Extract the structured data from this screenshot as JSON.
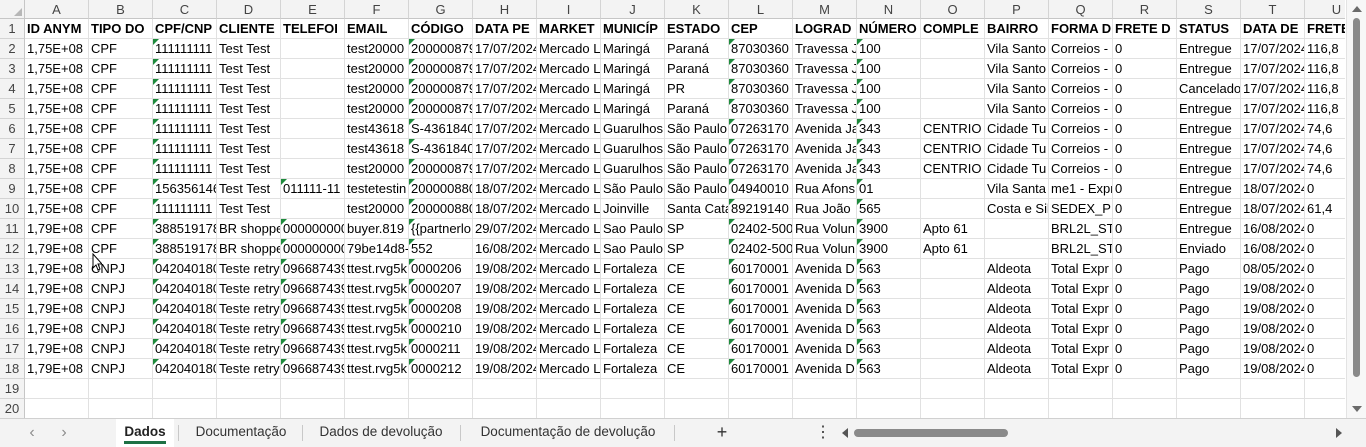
{
  "columns": [
    "A",
    "B",
    "C",
    "D",
    "E",
    "F",
    "G",
    "H",
    "I",
    "J",
    "K",
    "L",
    "M",
    "N",
    "O",
    "P",
    "Q",
    "R",
    "S",
    "T",
    "U"
  ],
  "row_numbers": [
    "1",
    "2",
    "3",
    "4",
    "5",
    "6",
    "7",
    "8",
    "9",
    "10",
    "11",
    "12",
    "13",
    "14",
    "15",
    "16",
    "17",
    "18",
    "19",
    "20"
  ],
  "headers": [
    "ID ANYM",
    "TIPO DO",
    "CPF/CNP",
    "CLIENTE",
    "TELEFOI",
    "EMAIL",
    "CÓDIGO",
    "DATA PE",
    "MARKET",
    "MUNICÍP",
    "ESTADO",
    "CEP",
    "LOGRAD",
    "NÚMERO",
    "COMPLE",
    "BAIRRO",
    "FORMA D",
    "FRETE D",
    "STATUS",
    "DATA DE",
    "FRETE"
  ],
  "rows": [
    [
      "1,75E+08",
      "CPF",
      "111111111",
      "Test Test",
      "",
      "test20000",
      "200000879",
      "17/07/2024",
      "Mercado L",
      "Maringá",
      "Paraná",
      "87030360",
      "Travessa J",
      "100",
      "",
      "Vila Santo",
      "Correios -",
      "0",
      "Entregue",
      "17/07/2024",
      "116,8"
    ],
    [
      "1,75E+08",
      "CPF",
      "111111111",
      "Test Test",
      "",
      "test20000",
      "200000879",
      "17/07/2024",
      "Mercado L",
      "Maringá",
      "Paraná",
      "87030360",
      "Travessa J",
      "100",
      "",
      "Vila Santo",
      "Correios -",
      "0",
      "Entregue",
      "17/07/2024",
      "116,8"
    ],
    [
      "1,75E+08",
      "CPF",
      "111111111",
      "Test Test",
      "",
      "test20000",
      "200000879",
      "17/07/2024",
      "Mercado L",
      "Maringá",
      "PR",
      "87030360",
      "Travessa J",
      "100",
      "",
      "Vila Santo",
      "Correios -",
      "0",
      "Cancelado",
      "17/07/2024",
      "116,8"
    ],
    [
      "1,75E+08",
      "CPF",
      "111111111",
      "Test Test",
      "",
      "test20000",
      "200000879",
      "17/07/2024",
      "Mercado L",
      "Maringá",
      "Paraná",
      "87030360",
      "Travessa J",
      "100",
      "",
      "Vila Santo",
      "Correios -",
      "0",
      "Entregue",
      "17/07/2024",
      "116,8"
    ],
    [
      "1,75E+08",
      "CPF",
      "111111111",
      "Test Test",
      "",
      "test43618",
      "S-4361840",
      "17/07/2024",
      "Mercado L",
      "Guarulhos",
      "São Paulo",
      "07263170",
      "Avenida Ja",
      "343",
      "CENTRIO",
      "Cidade Tu",
      "Correios -",
      "0",
      "Entregue",
      "17/07/2024",
      "74,6"
    ],
    [
      "1,75E+08",
      "CPF",
      "111111111",
      "Test Test",
      "",
      "test43618",
      "S-4361840",
      "17/07/2024",
      "Mercado L",
      "Guarulhos",
      "São Paulo",
      "07263170",
      "Avenida Ja",
      "343",
      "CENTRIO",
      "Cidade Tu",
      "Correios -",
      "0",
      "Entregue",
      "17/07/2024",
      "74,6"
    ],
    [
      "1,75E+08",
      "CPF",
      "111111111",
      "Test Test",
      "",
      "test20000",
      "200000879",
      "17/07/2024",
      "Mercado L",
      "Guarulhos",
      "São Paulo",
      "07263170",
      "Avenida Ja",
      "343",
      "CENTRIO",
      "Cidade Tu",
      "Correios -",
      "0",
      "Entregue",
      "17/07/2024",
      "74,6"
    ],
    [
      "1,75E+08",
      "CPF",
      "156356146",
      "Test Test",
      "011111-11",
      "testetestin",
      "200000880",
      "18/07/2024",
      "Mercado L",
      "São Paulo",
      "São Paulo",
      "04940010",
      "Rua Afons",
      "01",
      "",
      "Vila Santa",
      "me1 - Expr",
      "0",
      "Entregue",
      "18/07/2024",
      "0"
    ],
    [
      "1,75E+08",
      "CPF",
      "111111111",
      "Test Test",
      "",
      "test20000",
      "200000880",
      "18/07/2024",
      "Mercado L",
      "Joinville",
      "Santa Cata",
      "89219140",
      "Rua João",
      "565",
      "",
      "Costa e Sil",
      "SEDEX_PL/",
      "0",
      "Entregue",
      "18/07/2024",
      "61,4"
    ],
    [
      "1,79E+08",
      "CPF",
      "388519178",
      "BR shoppe",
      "000000000",
      "buyer.819",
      "{{partnerlo",
      "29/07/2024",
      "Mercado L",
      "Sao Paulo",
      "SP",
      "02402-500",
      "Rua Volun",
      "3900",
      "Apto 61",
      "",
      "BRL2L_STA",
      "0",
      "Entregue",
      "16/08/2024",
      "0"
    ],
    [
      "1,79E+08",
      "CPF",
      "388519178",
      "BR shoppe",
      "000000000",
      "79be14d8-",
      "552",
      "16/08/2024",
      "Mercado L",
      "Sao Paulo",
      "SP",
      "02402-500",
      "Rua Volun",
      "3900",
      "Apto 61",
      "",
      "BRL2L_STA",
      "0",
      "Enviado",
      "16/08/2024",
      "0"
    ],
    [
      "1,79E+08",
      "CNPJ",
      "042040180",
      "Teste retry",
      "096687439",
      "ttest.rvg5k",
      "0000206",
      "19/08/2024",
      "Mercado L",
      "Fortaleza",
      "CE",
      "60170001",
      "Avenida D",
      "563",
      "",
      "Aldeota",
      "Total Expr",
      "0",
      "Pago",
      "08/05/2024",
      "0"
    ],
    [
      "1,79E+08",
      "CNPJ",
      "042040180",
      "Teste retry",
      "096687439",
      "ttest.rvg5k",
      "0000207",
      "19/08/2024",
      "Mercado L",
      "Fortaleza",
      "CE",
      "60170001",
      "Avenida D",
      "563",
      "",
      "Aldeota",
      "Total Expr",
      "0",
      "Pago",
      "19/08/2024",
      "0"
    ],
    [
      "1,79E+08",
      "CNPJ",
      "042040180",
      "Teste retry",
      "096687439",
      "ttest.rvg5k",
      "0000208",
      "19/08/2024",
      "Mercado L",
      "Fortaleza",
      "CE",
      "60170001",
      "Avenida D",
      "563",
      "",
      "Aldeota",
      "Total Expr",
      "0",
      "Pago",
      "19/08/2024",
      "0"
    ],
    [
      "1,79E+08",
      "CNPJ",
      "042040180",
      "Teste retry",
      "096687439",
      "ttest.rvg5k",
      "0000210",
      "19/08/2024",
      "Mercado L",
      "Fortaleza",
      "CE",
      "60170001",
      "Avenida D",
      "563",
      "",
      "Aldeota",
      "Total Expr",
      "0",
      "Pago",
      "19/08/2024",
      "0"
    ],
    [
      "1,79E+08",
      "CNPJ",
      "042040180",
      "Teste retry",
      "096687439",
      "ttest.rvg5k",
      "0000211",
      "19/08/2024",
      "Mercado L",
      "Fortaleza",
      "CE",
      "60170001",
      "Avenida D",
      "563",
      "",
      "Aldeota",
      "Total Expr",
      "0",
      "Pago",
      "19/08/2024",
      "0"
    ],
    [
      "1,79E+08",
      "CNPJ",
      "042040180",
      "Teste retry",
      "096687439",
      "ttest.rvg5k",
      "0000212",
      "19/08/2024",
      "Mercado L",
      "Fortaleza",
      "CE",
      "60170001",
      "Avenida D",
      "563",
      "",
      "Aldeota",
      "Total Expr",
      "0",
      "Pago",
      "19/08/2024",
      "0"
    ]
  ],
  "number_columns": [
    0,
    17,
    20
  ],
  "text_as_number_columns": [
    2,
    4,
    6,
    11,
    13
  ],
  "sheet_tabs": [
    "Dados",
    "Documentação",
    "Dados de devolução",
    "Documentação de devolução"
  ],
  "active_tab": "Dados",
  "icons": {
    "nav_prev": "chevron-left-icon",
    "nav_next": "chevron-right-icon",
    "add_sheet": "plus-icon",
    "more": "more-options-icon"
  },
  "colors": {
    "error_indicator": "#1e8a3c",
    "active_tab_underline": "#1e7145"
  }
}
